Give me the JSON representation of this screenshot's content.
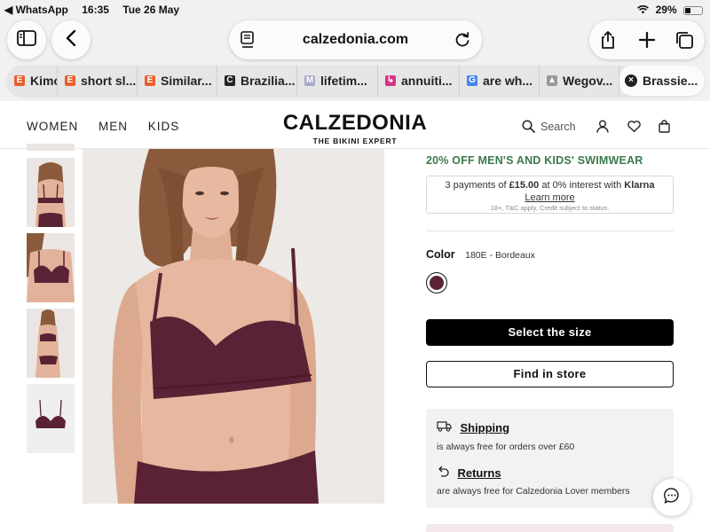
{
  "status_bar": {
    "back_app": "◀ WhatsApp",
    "time": "16:35",
    "date": "Tue 26 May",
    "battery": "29%",
    "battery_level": 0.29
  },
  "browser": {
    "url_domain": "calzedonia.com",
    "tabs": [
      {
        "label": "Kimo",
        "favicon": "E",
        "favicon_color": "#e8612c"
      },
      {
        "label": "short sl...",
        "favicon": "E",
        "favicon_color": "#e8612c"
      },
      {
        "label": "Similar...",
        "favicon": "E",
        "favicon_color": "#e8612c"
      },
      {
        "label": "Brazilia...",
        "favicon": "C",
        "favicon_color": "#222222"
      },
      {
        "label": "lifetim...",
        "favicon": "M",
        "favicon_color": "#a9a9c9"
      },
      {
        "label": "annuiti...",
        "favicon": "↳",
        "favicon_color": "#d63384"
      },
      {
        "label": "are wh...",
        "favicon": "G",
        "favicon_color": "#4285f4"
      },
      {
        "label": "Wegov...",
        "favicon": "▲",
        "favicon_color": "#9a9a9a"
      },
      {
        "label": "Brassie...",
        "favicon": "×",
        "favicon_color": "#222222"
      }
    ]
  },
  "site": {
    "nav": [
      "WOMEN",
      "MEN",
      "KIDS"
    ],
    "brand": "CALZEDONIA",
    "tagline": "THE BIKINI EXPERT",
    "search_placeholder": "Search"
  },
  "product": {
    "promo": "20% OFF MEN'S AND KIDS' SWIMWEAR",
    "klarna": {
      "prefix": "3 payments of ",
      "amount": "£15.00",
      "middle": " at 0% interest with ",
      "provider": "Klarna",
      "learn_more": "Learn more",
      "disclaimer": "18+, T&C apply, Credit subject to status."
    },
    "color_label": "Color",
    "color_value": "180E - Bordeaux",
    "swatch_color": "#5a2234",
    "select_size": "Select the size",
    "find_in_store": "Find in store",
    "shipping_title": "Shipping",
    "shipping_text": "is always free for orders over £60",
    "returns_title": "Returns",
    "returns_text": "are always free for Calzedonia Lover members"
  },
  "colors": {
    "accent_green": "#3b7a4a",
    "garment": "#5a2234",
    "skin": "#e6b8a0"
  }
}
